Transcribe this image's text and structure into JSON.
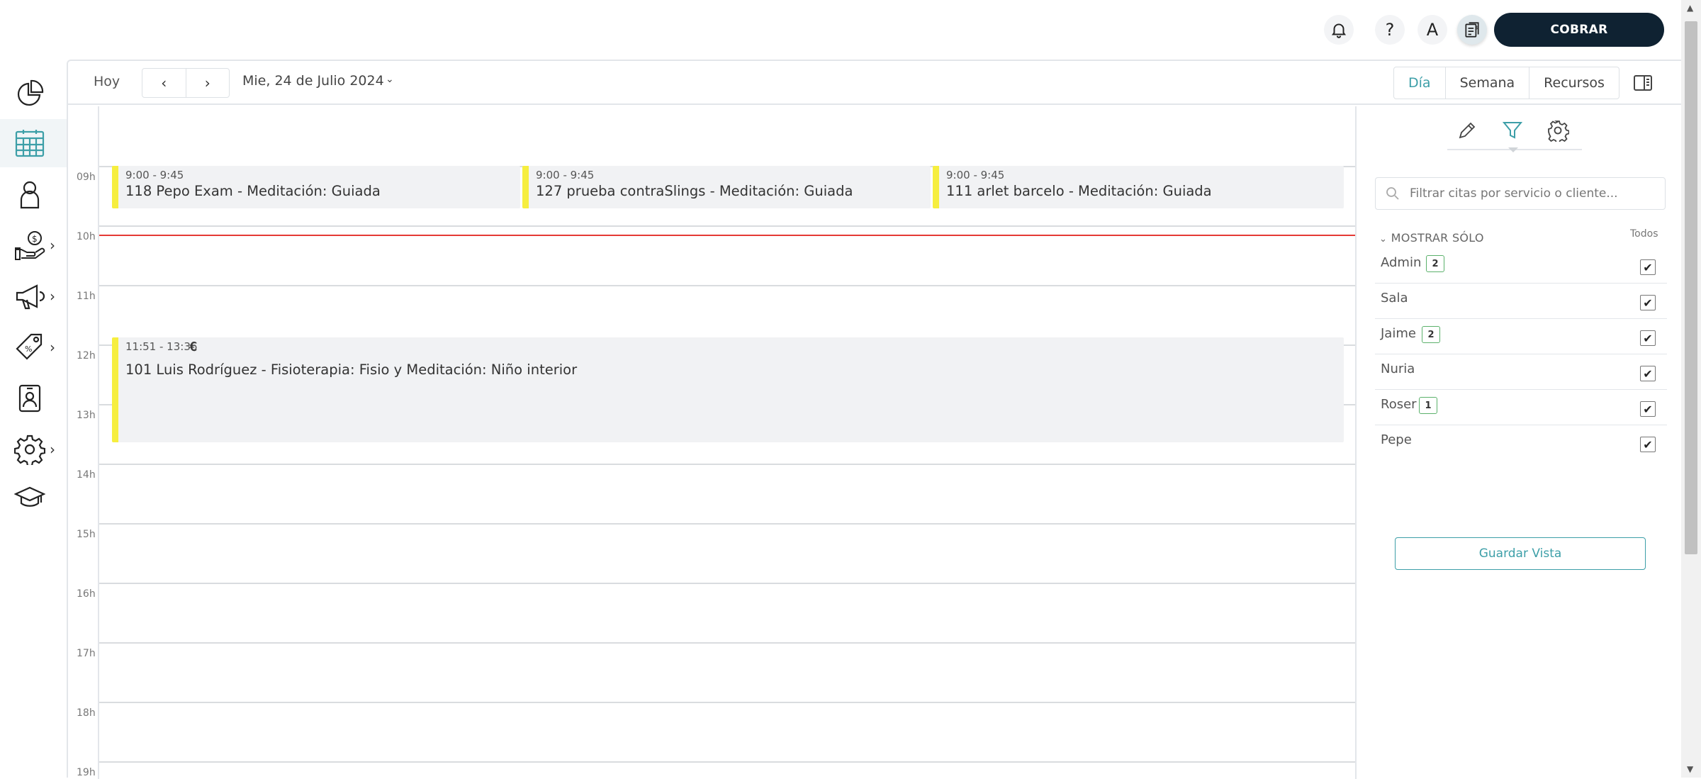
{
  "topbar": {
    "bell": "bell-icon",
    "help_label": "?",
    "avatar_initial": "A",
    "cash_register": "cash-register-icon",
    "cobrar_label": "COBRAR"
  },
  "sidebar": {
    "items": [
      {
        "icon": "pie-chart-icon",
        "has_submenu": false
      },
      {
        "icon": "calendar-icon",
        "has_submenu": false,
        "active": true
      },
      {
        "icon": "user-icon",
        "has_submenu": false
      },
      {
        "icon": "hand-money-icon",
        "has_submenu": true
      },
      {
        "icon": "megaphone-icon",
        "has_submenu": true
      },
      {
        "icon": "price-tag-icon",
        "has_submenu": true
      },
      {
        "icon": "staff-badge-icon",
        "has_submenu": false
      },
      {
        "icon": "gear-icon",
        "has_submenu": true
      },
      {
        "icon": "graduation-cap-icon",
        "has_submenu": false
      }
    ]
  },
  "toolbar": {
    "today_label": "Hoy",
    "prev_label": "‹",
    "next_label": "›",
    "date_label": "Mie, 24 de Julio 2024",
    "view_tabs": [
      {
        "label": "Día",
        "active": true
      },
      {
        "label": "Semana",
        "active": false
      },
      {
        "label": "Recursos",
        "active": false
      }
    ]
  },
  "calendar": {
    "hours": [
      "09h",
      "10h",
      "11h",
      "12h",
      "13h",
      "14h",
      "15h",
      "16h",
      "17h",
      "18h",
      "19h"
    ],
    "now_time": "10:09",
    "events": [
      {
        "time": "9:00 - 9:45",
        "title": "118 Pepo Exam - Meditación: Guiada",
        "color": "#f6ee3f"
      },
      {
        "time": "9:00 - 9:45",
        "title": "127 prueba contraSlings - Meditación: Guiada",
        "color": "#f6ee3f"
      },
      {
        "time": "9:00 - 9:45",
        "title": "111 arlet barcelo - Meditación: Guiada",
        "color": "#f6ee3f"
      },
      {
        "time": "11:51 - 13:36",
        "title": "101 Luis Rodríguez - Fisioterapia: Fisio y Meditación: Niño interior",
        "paid_symbol": "€",
        "color": "#f6ee3f"
      }
    ]
  },
  "filter_panel": {
    "tabs": [
      "pencil-icon",
      "filter-icon",
      "gear-icon"
    ],
    "active_tab": "filter-icon",
    "search_placeholder": "Filtrar citas por servicio o cliente...",
    "section_label": "MOSTRAR SÓLO",
    "all_label": "Todos",
    "staff": [
      {
        "name": "Admin",
        "count": "2",
        "checked": true
      },
      {
        "name": "Sala",
        "count": "",
        "checked": true
      },
      {
        "name": "Jaime",
        "count": "2",
        "checked": true
      },
      {
        "name": "Nuria",
        "count": "",
        "checked": true
      },
      {
        "name": "Roser",
        "count": "1",
        "checked": true
      },
      {
        "name": "Pepe",
        "count": "",
        "checked": true
      }
    ],
    "save_view_label": "Guardar Vista"
  },
  "colors": {
    "accent": "#3d9fa8",
    "primary_button": "#0f2232",
    "event_marker": "#f6ee3f",
    "now_line": "#e53935",
    "badge_border": "#5bb16b"
  }
}
